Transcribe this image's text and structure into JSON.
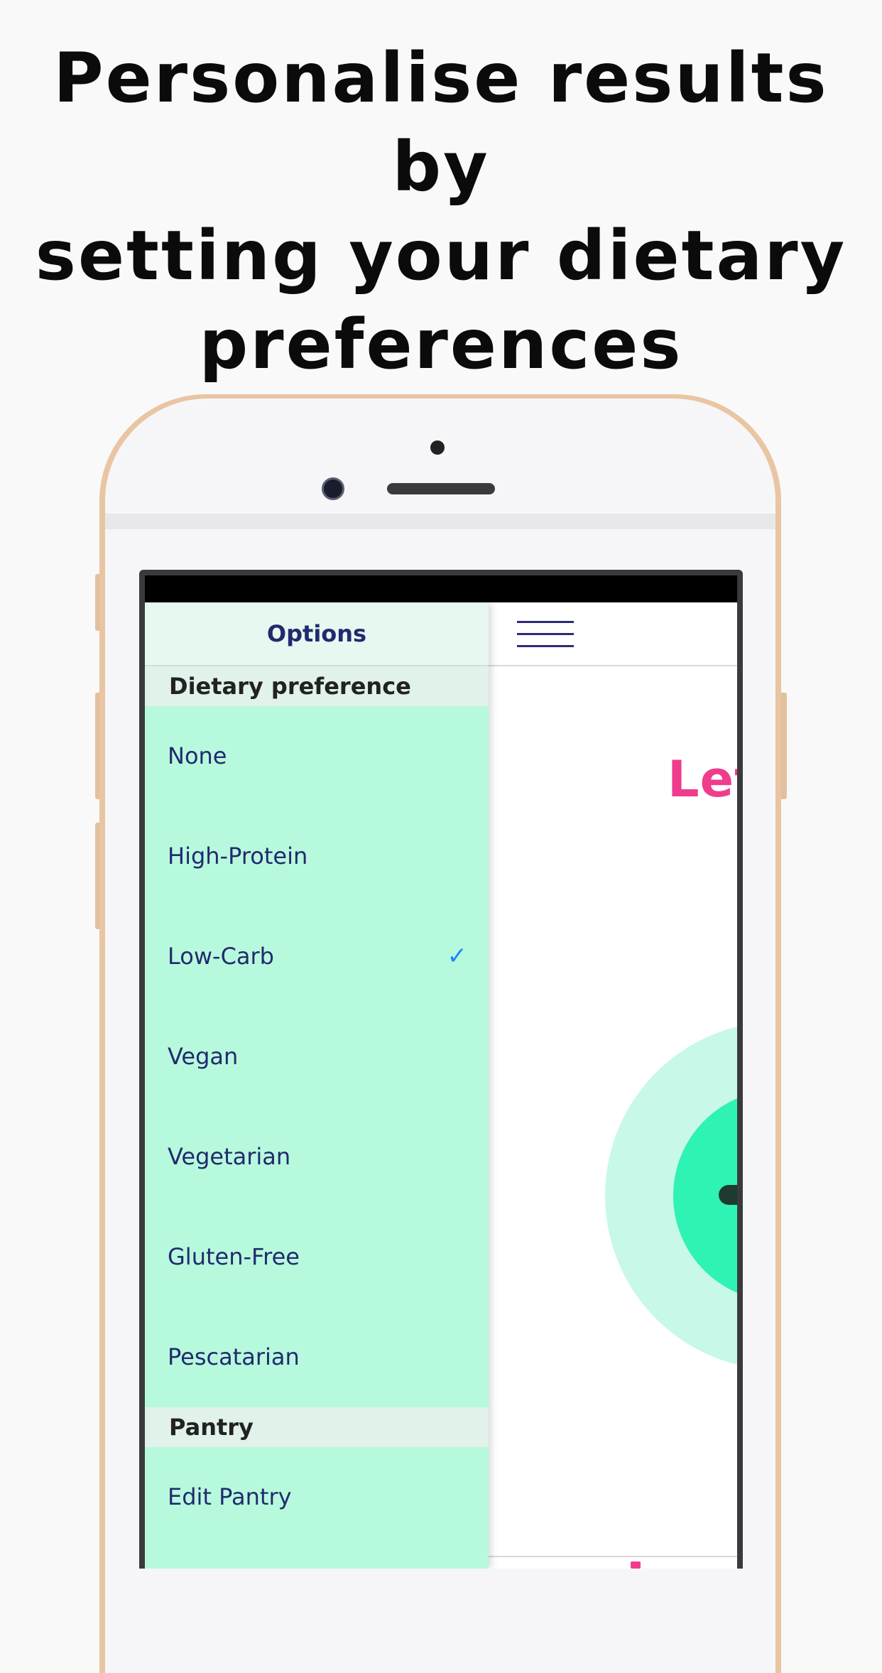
{
  "headline": "Personalise results by\nsetting your dietary\npreferences",
  "drawer": {
    "title": "Options",
    "dietary_section": "Dietary preference",
    "options": [
      {
        "label": "None",
        "selected": false
      },
      {
        "label": "High-Protein",
        "selected": false
      },
      {
        "label": "Low-Carb",
        "selected": true
      },
      {
        "label": "Vegan",
        "selected": false
      },
      {
        "label": "Vegetarian",
        "selected": false
      },
      {
        "label": "Gluten-Free",
        "selected": false
      },
      {
        "label": "Pescatarian",
        "selected": false
      }
    ],
    "pantry_section": "Pantry",
    "pantry_item": "Edit Pantry",
    "check_glyph": "✓"
  },
  "main": {
    "greeting_partial": "Let'"
  },
  "colors": {
    "drawer_bg": "#b7f9dd",
    "text_accent": "#222a6e",
    "check": "#1a8cf5",
    "greeting": "#f03c8d",
    "ring_light": "#c8f8e7",
    "ring_mid": "#2ff2b5"
  },
  "icons": [
    "hamburger-menu-icon",
    "checkmark-icon"
  ]
}
